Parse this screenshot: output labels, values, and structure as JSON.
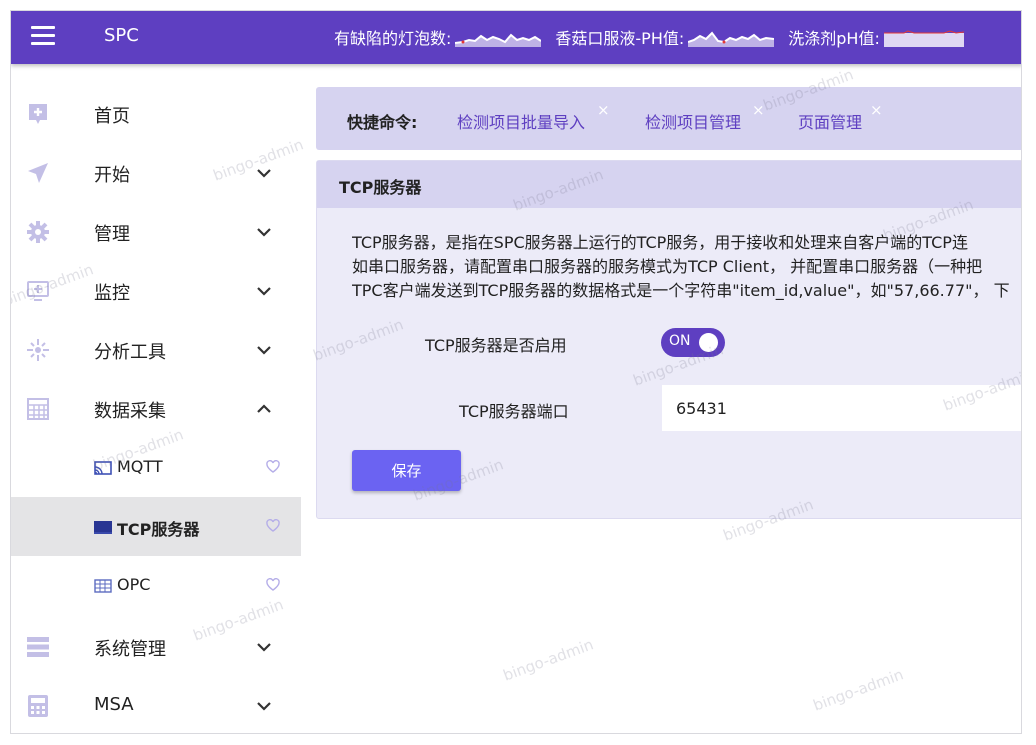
{
  "header": {
    "app_title": "SPC",
    "metrics": [
      {
        "label": "有缺陷的灯泡数:",
        "sparkline_color": "#ffffff"
      },
      {
        "label": "香菇口服液-PH值:",
        "sparkline_color": "#ffffff"
      },
      {
        "label": "洗涤剂pH值:",
        "sparkline_color": "#ffffff"
      }
    ]
  },
  "sidebar": {
    "items": [
      {
        "label": "首页",
        "icon": "home-card-icon"
      },
      {
        "label": "开始",
        "icon": "send-icon"
      },
      {
        "label": "管理",
        "icon": "gear-icon"
      },
      {
        "label": "监控",
        "icon": "monitor-icon"
      },
      {
        "label": "分析工具",
        "icon": "sparkle-icon"
      },
      {
        "label": "数据采集",
        "icon": "grid-icon"
      },
      {
        "label": "系统管理",
        "icon": "stack-icon"
      },
      {
        "label": "MSA",
        "icon": "calculator-icon"
      }
    ],
    "sub_items": [
      {
        "label": "MQTT",
        "icon": "cast-icon"
      },
      {
        "label": "TCP服务器",
        "icon": "screen-icon"
      },
      {
        "label": "OPC",
        "icon": "table-icon"
      }
    ]
  },
  "quickbar": {
    "label": "快捷命令:",
    "links": [
      "检测项目批量导入",
      "检测项目管理",
      "页面管理"
    ],
    "close_glyph": "×"
  },
  "panel": {
    "title": "TCP服务器",
    "description": [
      "TCP服务器，是指在SPC服务器上运行的TCP服务，用于接收和处理来自客户端的TCP连",
      "如串口服务器，请配置串口服务器的服务模式为TCP Client， 并配置串口服务器（一种把",
      "TPC客户端发送到TCP服务器的数据格式是一个字符串\"item_id,value\"，如\"57,66.77\"， 下"
    ],
    "enable_label": "TCP服务器是否启用",
    "toggle_text": "ON",
    "port_label": "TCP服务器端口",
    "port_value": "65431",
    "save_label": "保存"
  },
  "watermark": "bingo-admin",
  "colors": {
    "primary": "#5e3fc1",
    "quickbar_bg": "#d6d3f0",
    "panel_bg": "#ecebf8",
    "button": "#6b63f2",
    "sidebar_icon": "#c3bfe6"
  }
}
